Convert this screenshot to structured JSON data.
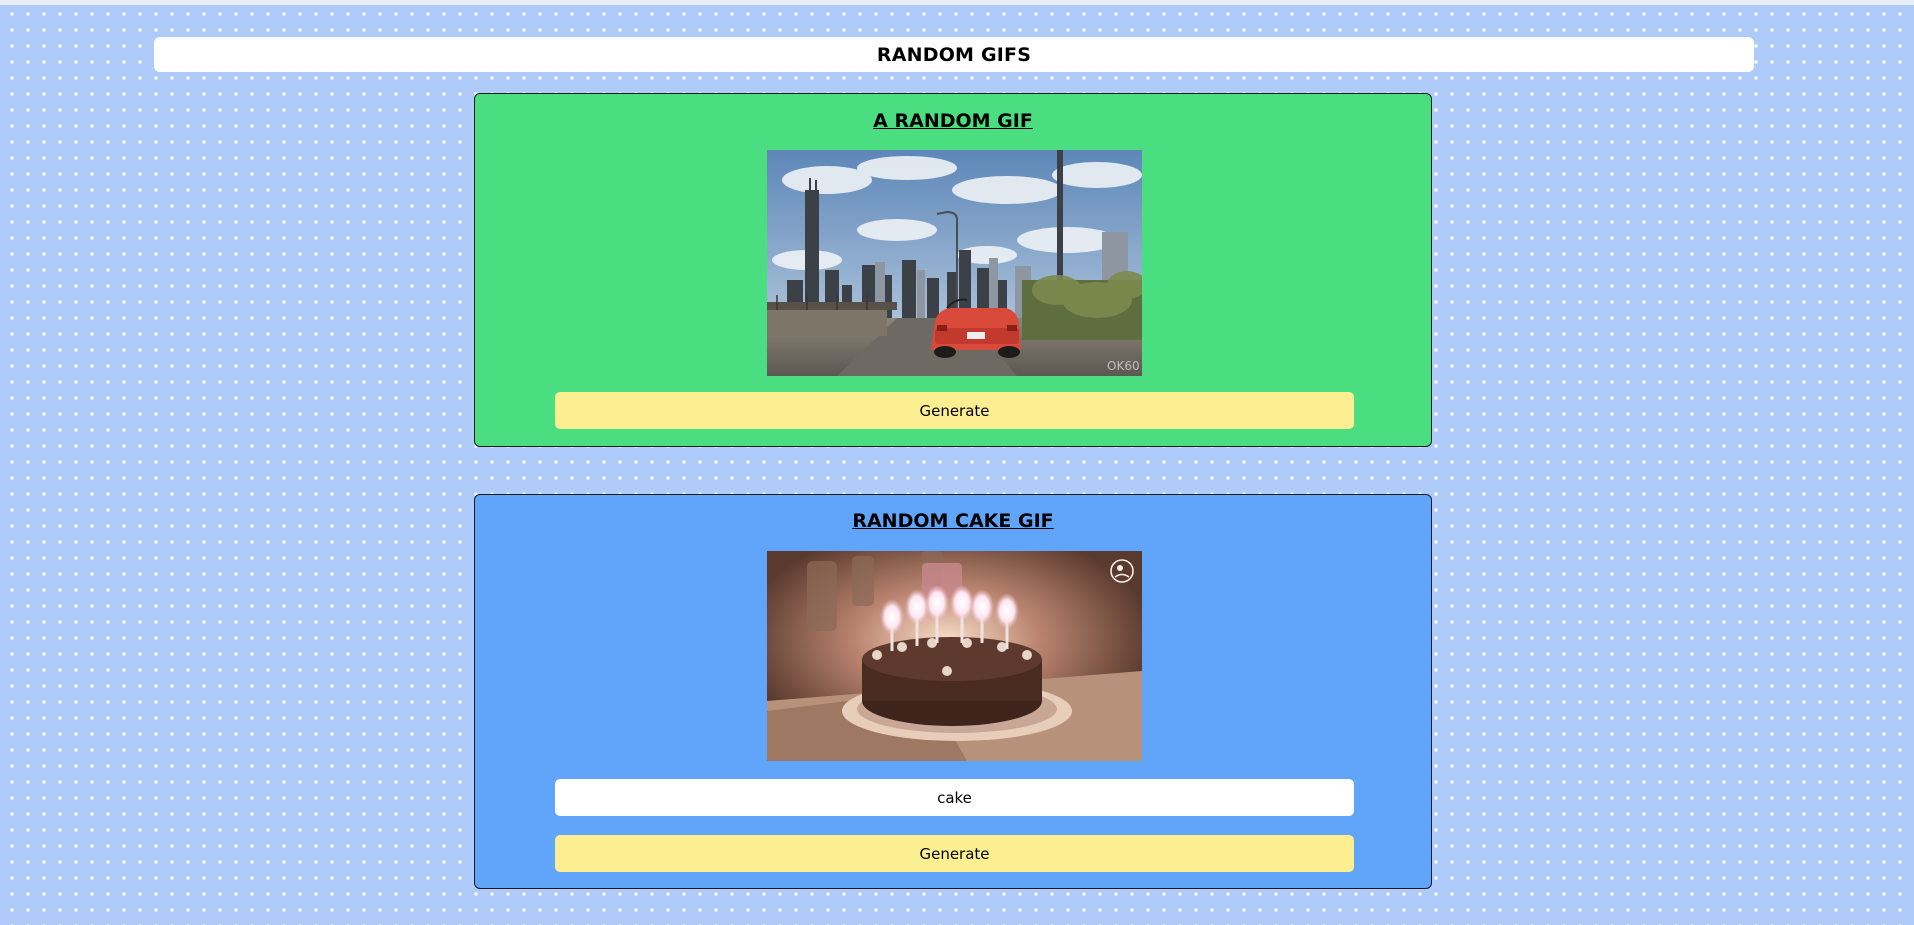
{
  "header": {
    "title": "RANDOM GIFS"
  },
  "random_card": {
    "title": "A RANDOM GIF",
    "gif_watermark": "OK60",
    "generate_label": "Generate",
    "bg_color": "#4ade80"
  },
  "cake_card": {
    "title": "RANDOM CAKE GIF",
    "search_value": "cake",
    "generate_label": "Generate",
    "bg_color": "#60a5fa"
  },
  "colors": {
    "page_bg": "#aecbfa",
    "button_bg": "#fcef91"
  }
}
